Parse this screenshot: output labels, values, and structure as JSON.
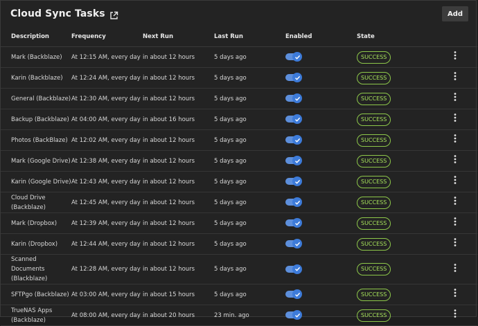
{
  "header": {
    "title": "Cloud Sync Tasks",
    "add_label": "Add"
  },
  "columns": [
    "Description",
    "Frequency",
    "Next Run",
    "Last Run",
    "Enabled",
    "State"
  ],
  "accent": "#3d7bd9",
  "success_color": "#a5e05a",
  "rows": [
    {
      "description": "Mark (Backblaze)",
      "frequency": "At 12:15 AM, every day",
      "next_run": "in about 12 hours",
      "last_run": "5 days ago",
      "enabled": true,
      "state": "SUCCESS"
    },
    {
      "description": "Karin (Backblaze)",
      "frequency": "At 12:24 AM, every day",
      "next_run": "in about 12 hours",
      "last_run": "5 days ago",
      "enabled": true,
      "state": "SUCCESS"
    },
    {
      "description": "General (Backblaze)",
      "frequency": "At 12:30 AM, every day",
      "next_run": "in about 12 hours",
      "last_run": "5 days ago",
      "enabled": true,
      "state": "SUCCESS"
    },
    {
      "description": "Backup (Backblaze)",
      "frequency": "At 04:00 AM, every day",
      "next_run": "in about 16 hours",
      "last_run": "5 days ago",
      "enabled": true,
      "state": "SUCCESS"
    },
    {
      "description": "Photos (BackBlaze)",
      "frequency": "At 12:02 AM, every day",
      "next_run": "in about 12 hours",
      "last_run": "5 days ago",
      "enabled": true,
      "state": "SUCCESS"
    },
    {
      "description": "Mark (Google Drive)",
      "frequency": "At 12:38 AM, every day",
      "next_run": "in about 12 hours",
      "last_run": "5 days ago",
      "enabled": true,
      "state": "SUCCESS"
    },
    {
      "description": "Karin (Google Drive)",
      "frequency": "At 12:43 AM, every day",
      "next_run": "in about 12 hours",
      "last_run": "5 days ago",
      "enabled": true,
      "state": "SUCCESS"
    },
    {
      "description": "Cloud Drive (Backblaze)",
      "frequency": "At 12:45 AM, every day",
      "next_run": "in about 12 hours",
      "last_run": "5 days ago",
      "enabled": true,
      "state": "SUCCESS"
    },
    {
      "description": "Mark (Dropbox)",
      "frequency": "At 12:39 AM, every day",
      "next_run": "in about 12 hours",
      "last_run": "5 days ago",
      "enabled": true,
      "state": "SUCCESS"
    },
    {
      "description": "Karin (Dropbox)",
      "frequency": "At 12:44 AM, every day",
      "next_run": "in about 12 hours",
      "last_run": "5 days ago",
      "enabled": true,
      "state": "SUCCESS"
    },
    {
      "description": "Scanned Documents (Blackblaze)",
      "frequency": "At 12:28 AM, every day",
      "next_run": "in about 12 hours",
      "last_run": "5 days ago",
      "enabled": true,
      "state": "SUCCESS"
    },
    {
      "description": "SFTPgo (Backblaze)",
      "frequency": "At 03:00 AM, every day",
      "next_run": "in about 15 hours",
      "last_run": "5 days ago",
      "enabled": true,
      "state": "SUCCESS"
    },
    {
      "description": "TrueNAS Apps (Backblaze)",
      "frequency": "At 08:00 AM, every day",
      "next_run": "in about 20 hours",
      "last_run": "23 min. ago",
      "enabled": true,
      "state": "SUCCESS"
    }
  ]
}
